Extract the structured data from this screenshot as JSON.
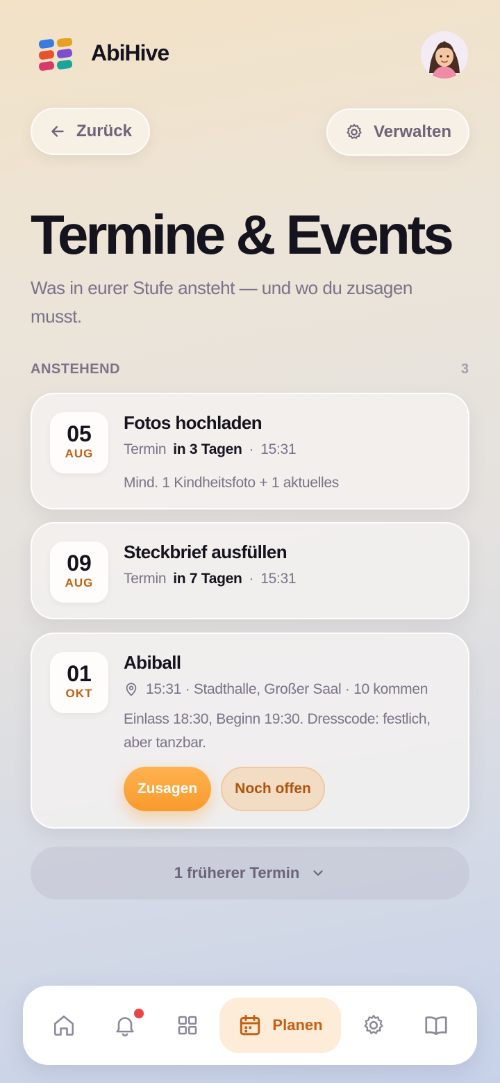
{
  "app": {
    "name": "AbiHive"
  },
  "header": {
    "back_label": "Zurück",
    "manage_label": "Verwalten"
  },
  "page": {
    "title": "Termine & Events",
    "subtitle": "Was in eurer Stufe ansteht — und wo du zusagen musst."
  },
  "section": {
    "label": "ANSTEHEND",
    "count": "3"
  },
  "events": [
    {
      "day": "05",
      "month": "AUG",
      "title": "Fotos hochladen",
      "type": "Termin",
      "relative": "in 3 Tagen",
      "time": "15:31",
      "description": "Mind. 1 Kindheitsfoto + 1 aktuelles"
    },
    {
      "day": "09",
      "month": "AUG",
      "title": "Steckbrief ausfüllen",
      "type": "Termin",
      "relative": "in 7 Tagen",
      "time": "15:31"
    },
    {
      "day": "01",
      "month": "OKT",
      "title": "Abiball",
      "meta": "15:31 · Stadthalle, Großer Saal · 10 kommen",
      "description": "Einlass 18:30, Beginn 19:30. Dresscode: festlich, aber tanzbar.",
      "rsvp_yes": "Zusagen",
      "rsvp_open": "Noch offen"
    }
  ],
  "earlier": {
    "label": "1 früherer Termin"
  },
  "tabbar": {
    "active_label": "Planen",
    "icons": [
      "home-icon",
      "bell-icon",
      "grid-icon",
      "calendar-icon",
      "gear-icon",
      "book-icon"
    ],
    "notification_dot": true
  },
  "colors": {
    "accent": "#f99a2c",
    "accent_text": "#c55f11",
    "text_dark": "#15131d",
    "text_muted": "#7a7388",
    "badge": "#e84545"
  }
}
